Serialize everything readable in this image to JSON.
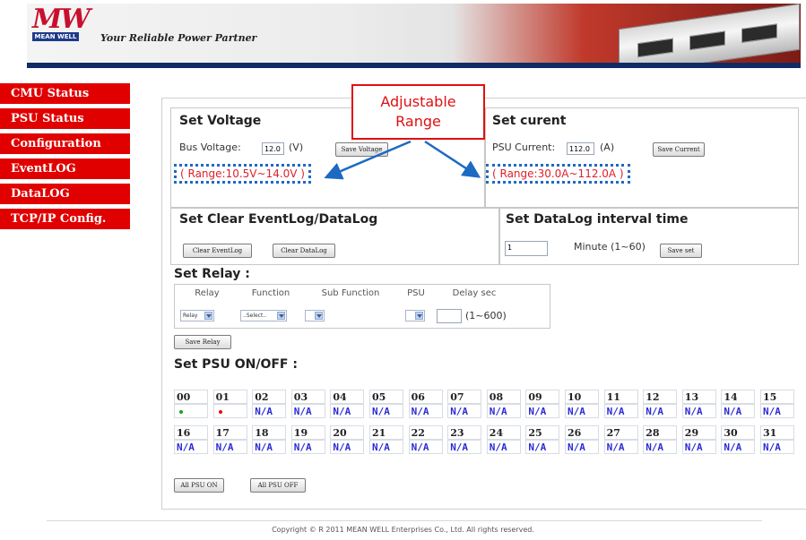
{
  "header": {
    "logo_text": "MW",
    "logo_brand": "MEAN WELL",
    "tagline": "Your Reliable Power Partner"
  },
  "sidebar": {
    "items": [
      {
        "label": "CMU Status"
      },
      {
        "label": "PSU Status"
      },
      {
        "label": "Configuration"
      },
      {
        "label": "EventLOG"
      },
      {
        "label": "DataLOG"
      },
      {
        "label": "TCP/IP Config."
      }
    ]
  },
  "annotation": {
    "callout_line1": "Adjustable",
    "callout_line2": "Range",
    "colors": {
      "callout": "#e01010",
      "range_box": "#1c6ac2",
      "arrow": "#1c6ac2"
    }
  },
  "set_voltage": {
    "title": "Set Voltage",
    "bus_label": "Bus Voltage:",
    "bus_value": "12.0",
    "unit": "(V)",
    "button": "Save Voltage",
    "range": "( Range:10.5V~14.0V )"
  },
  "set_current": {
    "title": "Set curent",
    "psu_label": "PSU Current:",
    "psu_value": "112.0",
    "unit": "(A)",
    "button": "Save Current",
    "range": "( Range:30.0A~112.0A )"
  },
  "set_clear": {
    "title": "Set Clear EventLog/DataLog",
    "btn_eventlog": "Clear EventLog",
    "btn_datalog": "Clear DataLog"
  },
  "datalog_interval": {
    "title": "Set DataLog interval time",
    "value": "1",
    "label": "Minute (1~60)",
    "button": "Save set"
  },
  "set_relay": {
    "title": "Set Relay :",
    "headers": [
      "Relay",
      "Function",
      "Sub Function",
      "PSU",
      "Delay sec"
    ],
    "relay_select": "Relay",
    "function_select": "..Select..",
    "delay_hint": "(1~600)",
    "button": "Save Relay"
  },
  "psu_onoff": {
    "title": "Set PSU ON/OFF :",
    "row1_ids": [
      "00",
      "01",
      "02",
      "03",
      "04",
      "05",
      "06",
      "07",
      "08",
      "09",
      "10",
      "11",
      "12",
      "13",
      "14",
      "15"
    ],
    "row1_vals": [
      "",
      "",
      "N/A",
      "N/A",
      "N/A",
      "N/A",
      "N/A",
      "N/A",
      "N/A",
      "N/A",
      "N/A",
      "N/A",
      "N/A",
      "N/A",
      "N/A",
      "N/A"
    ],
    "row2_ids": [
      "16",
      "17",
      "18",
      "19",
      "20",
      "21",
      "22",
      "23",
      "24",
      "25",
      "26",
      "27",
      "28",
      "29",
      "30",
      "31"
    ],
    "row2_vals": [
      "N/A",
      "N/A",
      "N/A",
      "N/A",
      "N/A",
      "N/A",
      "N/A",
      "N/A",
      "N/A",
      "N/A",
      "N/A",
      "N/A",
      "N/A",
      "N/A",
      "N/A",
      "N/A"
    ],
    "status_colors": {
      "on": "#1aa31a",
      "off": "#e01010"
    },
    "btn_all_on": "All PSU ON",
    "btn_all_off": "All PSU OFF"
  },
  "footer": {
    "copyright": "Copyright © R 2011 MEAN WELL Enterprises Co., Ltd. All rights reserved."
  }
}
